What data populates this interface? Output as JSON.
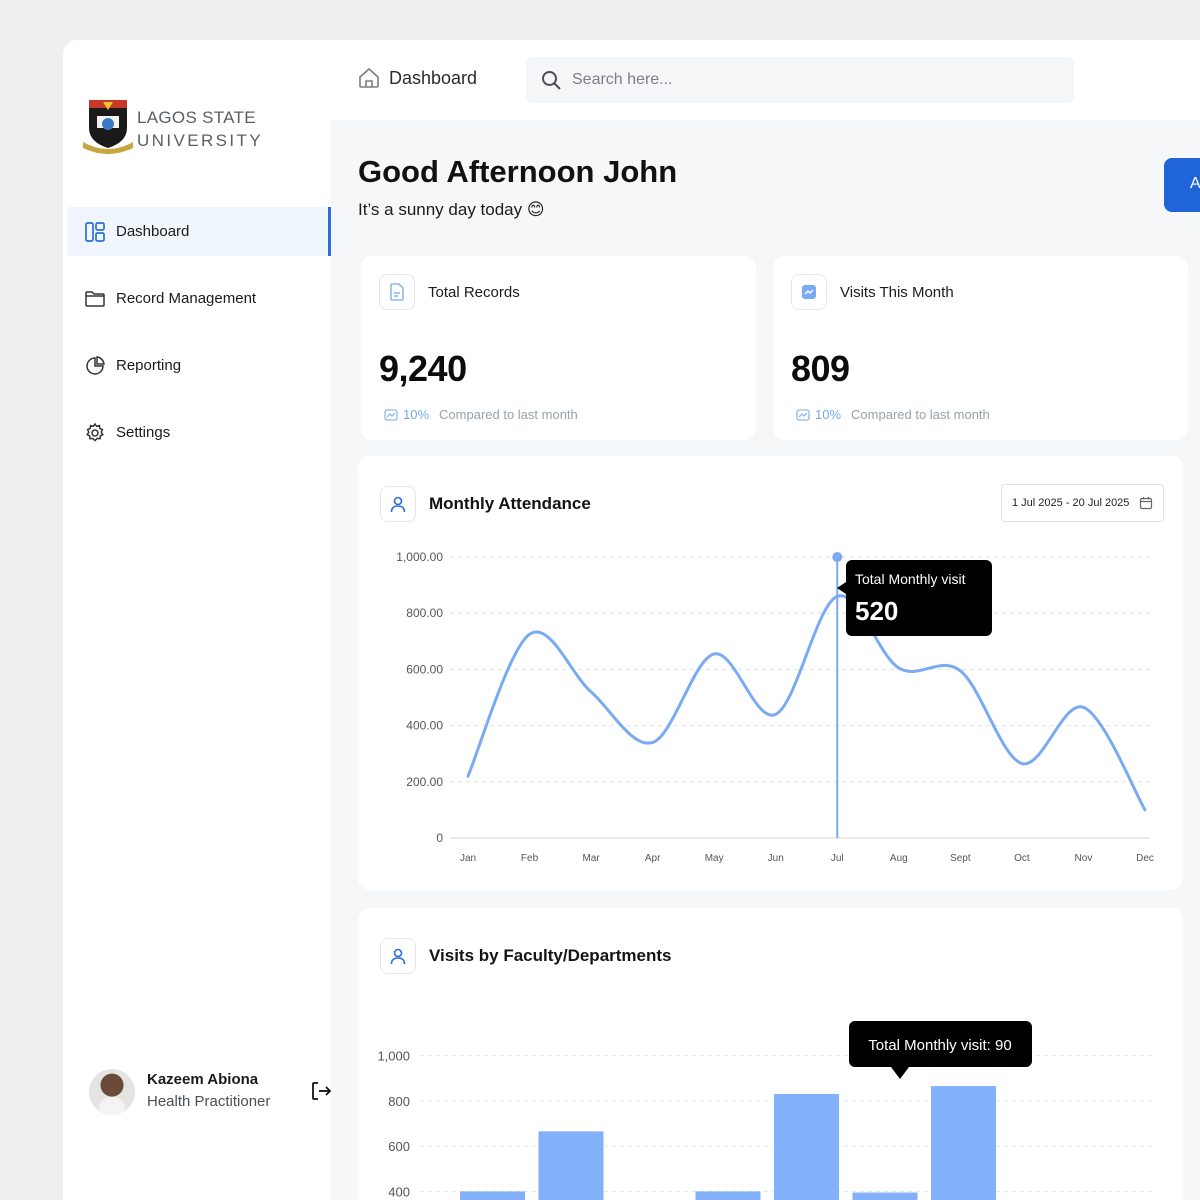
{
  "brand": {
    "line1": "LAGOS STATE",
    "line2": "UNIVERSITY"
  },
  "sidebar": {
    "items": [
      {
        "label": "Dashboard",
        "icon": "dashboard-icon",
        "active": true
      },
      {
        "label": "Record Management",
        "icon": "folder-icon"
      },
      {
        "label": "Reporting",
        "icon": "pie-chart-icon"
      },
      {
        "label": "Settings",
        "icon": "gear-icon"
      }
    ]
  },
  "profile": {
    "name": "Kazeem Abiona",
    "role": "Health Practitioner"
  },
  "topbar": {
    "breadcrumb": "Dashboard",
    "search_placeholder": "Search here..."
  },
  "greeting": {
    "title": "Good Afternoon John",
    "subtitle": "It’s a sunny day today 😊"
  },
  "cta": {
    "label": "A"
  },
  "stats": [
    {
      "title": "Total Records",
      "value": "9,240",
      "change": "10%",
      "compare": "Compared to last month"
    },
    {
      "title": "Visits This Month",
      "value": "809",
      "change": "10%",
      "compare": "Compared to last month"
    }
  ],
  "colors": {
    "accent": "#1f64d8",
    "line": "#7aabf2",
    "bar": "#82b1fa",
    "tooltip": "#000000"
  },
  "attendance": {
    "title": "Monthly Attendance",
    "date_range": "1 Jul 2025 - 20 Jul 2025",
    "tooltip_title": "Total Monthly visit",
    "tooltip_value": "520"
  },
  "faculty": {
    "title": "Visits by Faculty/Departments",
    "tooltip": "Total Monthly visit: 90"
  },
  "chart_data": [
    {
      "type": "line",
      "title": "Monthly Attendance",
      "x": [
        "Jan",
        "Feb",
        "Mar",
        "Apr",
        "May",
        "Jun",
        "Jul",
        "Aug",
        "Sept",
        "Oct",
        "Nov",
        "Dec"
      ],
      "y_tick_labels": [
        "0",
        "200.00",
        "400.00",
        "600.00",
        "800.00",
        "1,000.00"
      ],
      "ylim": [
        0,
        1000
      ],
      "grid": true,
      "highlight": "Jul",
      "series": [
        {
          "values": [
            220,
            725,
            520,
            340,
            655,
            440,
            860,
            605,
            595,
            265,
            465,
            100
          ]
        }
      ]
    },
    {
      "type": "bar",
      "title": "Visits by Faculty/Departments",
      "y_tick_labels": [
        "400",
        "600",
        "800",
        "1,000"
      ],
      "ylim": [
        0,
        1000
      ],
      "grid": true,
      "values": [
        400,
        665,
        null,
        400,
        830,
        395,
        865
      ]
    }
  ]
}
